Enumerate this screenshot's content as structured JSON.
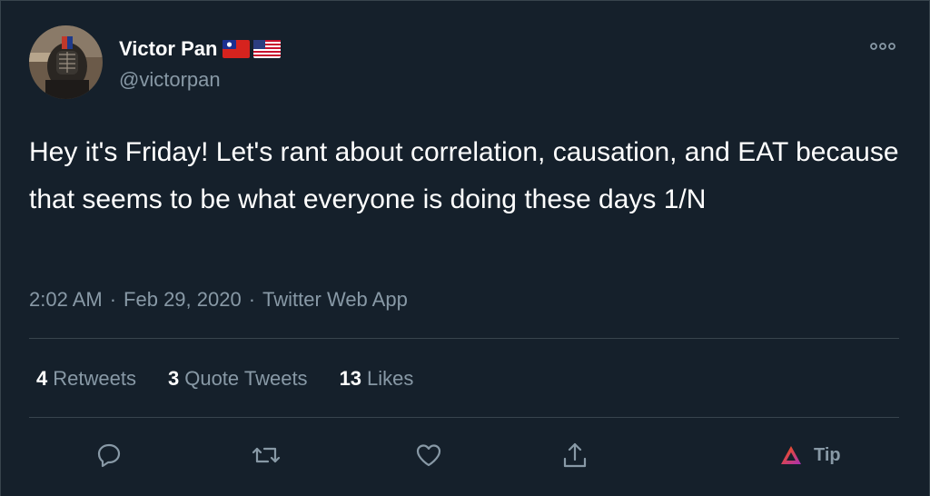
{
  "user": {
    "display_name": "Victor Pan",
    "handle": "@victorpan",
    "flags": [
      "taiwan-flag",
      "us-flag"
    ]
  },
  "tweet": {
    "text": "Hey it's Friday! Let's rant about correlation, causation, and EAT because that seems to be what everyone is doing these days 1/N",
    "time": "2:02 AM",
    "separator": "·",
    "date": "Feb 29, 2020",
    "source": "Twitter Web App"
  },
  "stats": {
    "retweets": {
      "count": "4",
      "label": "Retweets"
    },
    "quotes": {
      "count": "3",
      "label": "Quote Tweets"
    },
    "likes": {
      "count": "13",
      "label": "Likes"
    }
  },
  "actions": {
    "tip_label": "Tip"
  },
  "icons": {
    "more": "more-horizontal-icon",
    "reply": "reply-icon",
    "retweet": "retweet-icon",
    "like": "heart-icon",
    "share": "share-icon",
    "tip": "brave-triangle-icon"
  },
  "colors": {
    "background": "#15202b",
    "text": "#ffffff",
    "secondary": "#8899a6",
    "border": "#38444d"
  }
}
